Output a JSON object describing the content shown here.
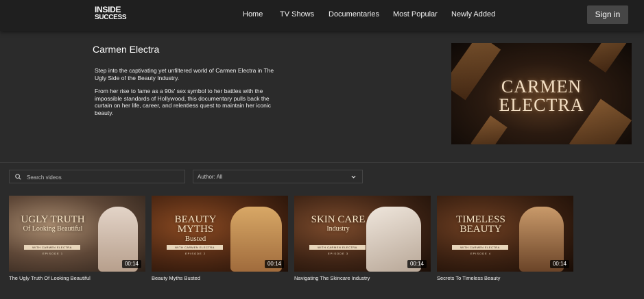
{
  "header": {
    "logo": {
      "line1": "INSIDE",
      "line2": "SUCCESS"
    },
    "nav": [
      {
        "label": "Home"
      },
      {
        "label": "TV Shows"
      },
      {
        "label": "Documentaries"
      },
      {
        "label": "Most Popular"
      },
      {
        "label": "Newly Added"
      }
    ],
    "signin_label": "Sign in"
  },
  "hero": {
    "title": "Carmen Electra",
    "paragraph1": "Step into the captivating yet unfiltered world of Carmen Electra in The Ugly Side of the Beauty Industry.",
    "paragraph2": "From her rise to fame as a 90s' sex symbol to her battles with the impossible standards of Hollywood, this documentary pulls back the curtain on her life, career, and relentless quest to maintain her iconic beauty.",
    "image_text_line1": "CARMEN",
    "image_text_line2": "ELECTRA"
  },
  "filters": {
    "search_placeholder": "Search videos",
    "author_label": "Author: All"
  },
  "videos": [
    {
      "title": "The Ugly Truth Of Looking Beautiful",
      "thumb_line1": "UGLY TRUTH",
      "thumb_line2": "Of Looking Beautiful",
      "thumb_sub": "WITH CARMEN ELECTRA",
      "thumb_ep": "EPISODE 1",
      "duration": "00:14"
    },
    {
      "title": "Beauty Myths Busted",
      "thumb_line1": "BEAUTY MYTHS",
      "thumb_line2": "Busted",
      "thumb_sub": "WITH CARMEN ELECTRA",
      "thumb_ep": "EPISODE 2",
      "duration": "00:14"
    },
    {
      "title": "Navigating The Skincare Industry",
      "thumb_line1": "SKIN CARE",
      "thumb_line2": "Industry",
      "thumb_sub": "WITH CARMEN ELECTRA",
      "thumb_ep": "EPISODE 3",
      "duration": "00:14"
    },
    {
      "title": "Secrets To Timeless Beauty",
      "thumb_line1": "TIMELESS BEAUTY",
      "thumb_line2": "",
      "thumb_sub": "WITH CARMEN ELECTRA",
      "thumb_ep": "EPISODE 4",
      "duration": "00:14"
    }
  ],
  "icons": {
    "search": "search-icon",
    "dropdown": "chevron-down-icon"
  }
}
